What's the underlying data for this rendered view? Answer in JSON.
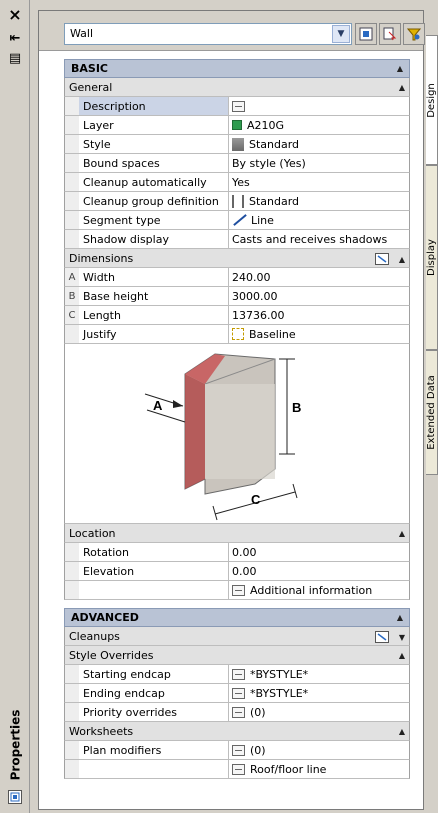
{
  "left_strip": {
    "close_glyph": "×",
    "autohide_glyph": "⇤",
    "menu_glyph": "▤",
    "panel_title": "Properties"
  },
  "tabs": [
    "Design",
    "Display",
    "Extended Data"
  ],
  "toolbar": {
    "object_type": "Wall"
  },
  "basic": {
    "title": "BASIC",
    "general": {
      "title": "General",
      "rows": [
        {
          "name": "Description",
          "value": "",
          "icon": "doc-icon"
        },
        {
          "name": "Layer",
          "value": "A210G",
          "icon": "layer-color-icon"
        },
        {
          "name": "Style",
          "value": "Standard",
          "icon": "wall-style-icon"
        },
        {
          "name": "Bound spaces",
          "value": "By style (Yes)",
          "icon": ""
        },
        {
          "name": "Cleanup automatically",
          "value": "Yes",
          "icon": ""
        },
        {
          "name": "Cleanup group definition",
          "value": "Standard",
          "icon": "cleanup-group-icon"
        },
        {
          "name": "Segment type",
          "value": "Line",
          "icon": "line-segment-icon"
        },
        {
          "name": "Shadow display",
          "value": "Casts and receives shadows",
          "icon": ""
        }
      ]
    },
    "dimensions": {
      "title": "Dimensions",
      "rows": [
        {
          "key": "A",
          "name": "Width",
          "value": "240.00"
        },
        {
          "key": "B",
          "name": "Base height",
          "value": "3000.00"
        },
        {
          "key": "C",
          "name": "Length",
          "value": "13736.00"
        },
        {
          "key": "",
          "name": "Justify",
          "value": "Baseline"
        }
      ],
      "diagram_labels": {
        "a": "A",
        "b": "B",
        "c": "C"
      }
    },
    "location": {
      "title": "Location",
      "rows": [
        {
          "name": "Rotation",
          "value": "0.00"
        },
        {
          "name": "Elevation",
          "value": "0.00"
        },
        {
          "name": "",
          "value": "Additional information"
        }
      ]
    }
  },
  "advanced": {
    "title": "ADVANCED",
    "cleanups": {
      "title": "Cleanups"
    },
    "style_overrides": {
      "title": "Style Overrides",
      "rows": [
        {
          "name": "Starting endcap",
          "value": "*BYSTYLE*"
        },
        {
          "name": "Ending endcap",
          "value": "*BYSTYLE*"
        },
        {
          "name": "Priority overrides",
          "value": "(0)"
        }
      ]
    },
    "worksheets": {
      "title": "Worksheets",
      "rows": [
        {
          "name": "Plan modifiers",
          "value": "(0)"
        },
        {
          "name": "",
          "value": "Roof/floor line"
        }
      ]
    }
  }
}
